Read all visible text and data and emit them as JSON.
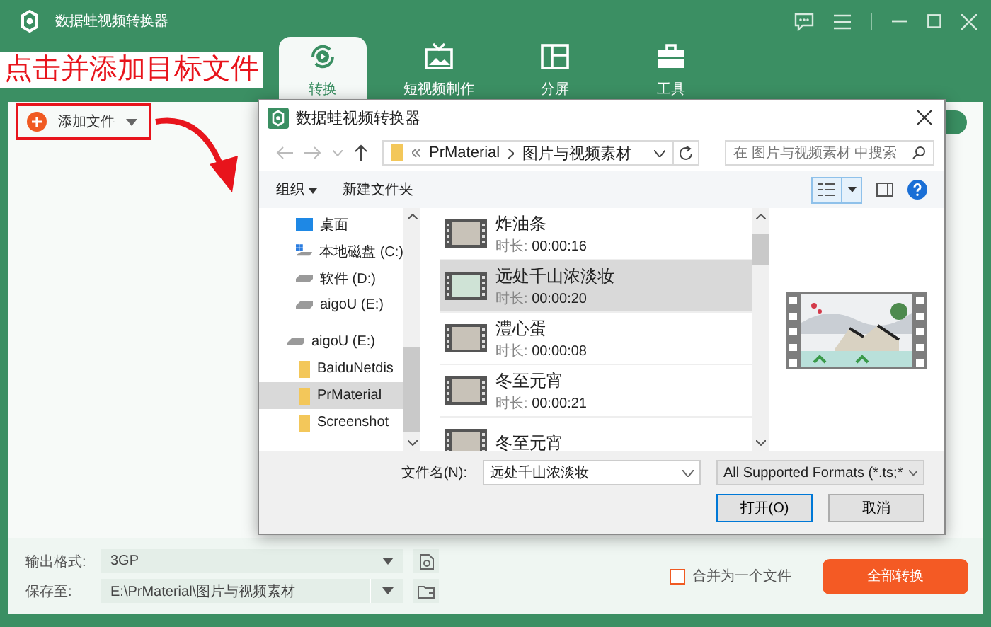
{
  "app": {
    "title": "数据蛙视频转换器"
  },
  "tabs": [
    {
      "label": "转换",
      "selected": true
    },
    {
      "label": "短视频制作",
      "selected": false
    },
    {
      "label": "分屏",
      "selected": false
    },
    {
      "label": "工具",
      "selected": false
    }
  ],
  "annotation": {
    "text": "点击并添加目标文件"
  },
  "toolbar": {
    "add_button": "添加文件"
  },
  "dialog": {
    "title": "数据蛙视频转换器",
    "path": [
      "PrMaterial",
      "图片与视频素材"
    ],
    "search": {
      "placeholder": "在 图片与视频素材 中搜索"
    },
    "organize": "组织",
    "new_folder": "新建文件夹",
    "nav": {
      "pc_items": [
        {
          "label": "桌面",
          "kind": "desktop",
          "selected": false
        },
        {
          "label": "本地磁盘 (C:)",
          "kind": "system_drive",
          "selected": false
        },
        {
          "label": "软件 (D:)",
          "kind": "drive",
          "selected": false
        },
        {
          "label": "aigoU (E:)",
          "kind": "drive",
          "selected": false
        }
      ],
      "drives": [
        {
          "label": "aigoU (E:)",
          "kind": "drive",
          "selected": false,
          "children": [
            {
              "label": "BaiduNetdis",
              "kind": "folder",
              "selected": false
            },
            {
              "label": "PrMaterial",
              "kind": "folder",
              "selected": true
            },
            {
              "label": "Screenshot",
              "kind": "folder",
              "selected": false
            }
          ]
        }
      ]
    },
    "files": [
      {
        "name": "炸油条",
        "duration_label": "时长:",
        "duration": "00:00:16",
        "selected": false
      },
      {
        "name": "远处千山浓淡妆",
        "duration_label": "时长:",
        "duration": "00:00:20",
        "selected": true
      },
      {
        "name": "澧心蛋",
        "duration_label": "时长:",
        "duration": "00:00:08",
        "selected": false
      },
      {
        "name": "冬至元宵",
        "duration_label": "时长:",
        "duration": "00:00:21",
        "selected": false
      },
      {
        "name": "冬至元宵",
        "selected": false
      }
    ],
    "filename_label": "文件名(N):",
    "filename": "远处千山浓淡妆",
    "filter": "All Supported Formats (*.ts;*",
    "buttons": [
      "打开(O)",
      "取消"
    ]
  },
  "bottom": {
    "format_label": "输出格式:",
    "format": "3GP",
    "save_label": "保存至:",
    "save_path": "E:\\PrMaterial\\图片与视频素材",
    "merge": {
      "label": "合并为一个文件",
      "checked": false
    },
    "convert_all": "全部转换"
  }
}
